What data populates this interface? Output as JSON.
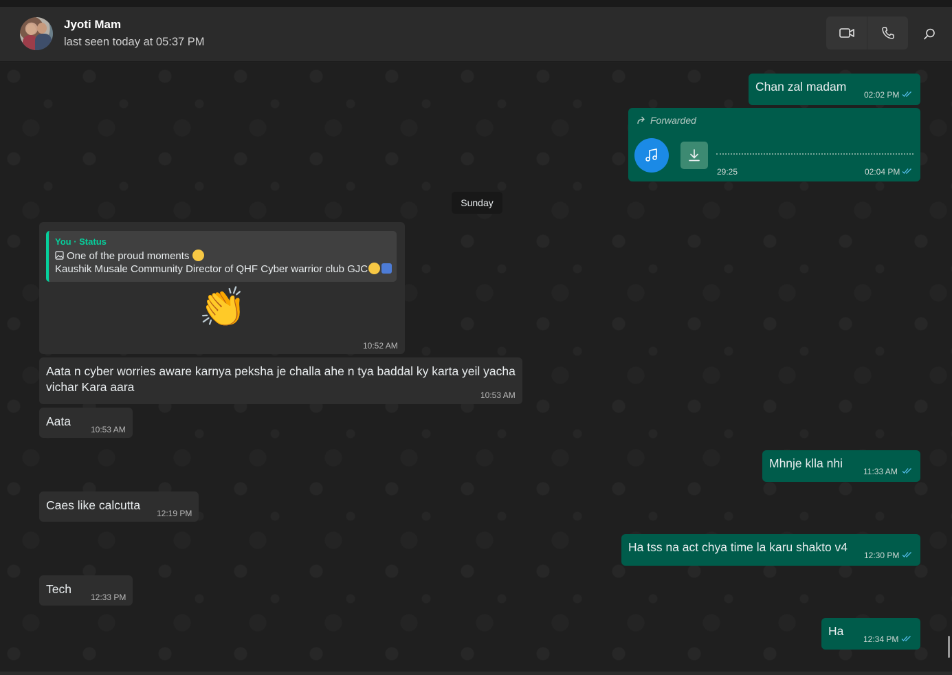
{
  "header": {
    "contact_name": "Jyoti Mam",
    "last_seen": "last seen today at 05:37 PM"
  },
  "date_separator": "Sunday",
  "messages": {
    "m1": {
      "text": "Chan zal madam",
      "time": "02:02 PM"
    },
    "m2": {
      "forwarded_label": "Forwarded",
      "duration": "29:25",
      "time": "02:04 PM"
    },
    "m3": {
      "quote_header": "You · Status",
      "quote_line1": "One of the proud moments",
      "quote_line2": "Kaushik Musale Community Director of QHF Cyber warrior club GJC",
      "emoji": "👏",
      "time": "10:52 AM"
    },
    "m4": {
      "line1": "Aata n cyber worries aware karnya peksha je challa ahe n tya baddal ky karta yeil yacha",
      "line2": "vichar Kara aara",
      "time": "10:53 AM"
    },
    "m5": {
      "text": "Aata",
      "time": "10:53 AM"
    },
    "m6": {
      "text": "Mhnje klla nhi",
      "time": "11:33 AM"
    },
    "m7": {
      "text": "Caes like calcutta",
      "time": "12:19 PM"
    },
    "m8": {
      "text": "Ha tss na act chya time la karu shakto v4",
      "time": "12:30 PM"
    },
    "m9": {
      "text": "Tech",
      "time": "12:33 PM"
    },
    "m10": {
      "text": "Ha",
      "time": "12:34 PM"
    }
  },
  "icons": {
    "video": "video-camera-icon",
    "call": "phone-icon",
    "search": "search-icon",
    "tick": "double-check-icon",
    "music": "music-note-icon",
    "download": "download-icon",
    "forward": "forward-arrow-icon"
  },
  "colors": {
    "outgoing_bubble": "#005c4b",
    "incoming_bubble": "#2e2e2e",
    "accent": "#06cf9c",
    "read_tick": "#53bdeb"
  }
}
